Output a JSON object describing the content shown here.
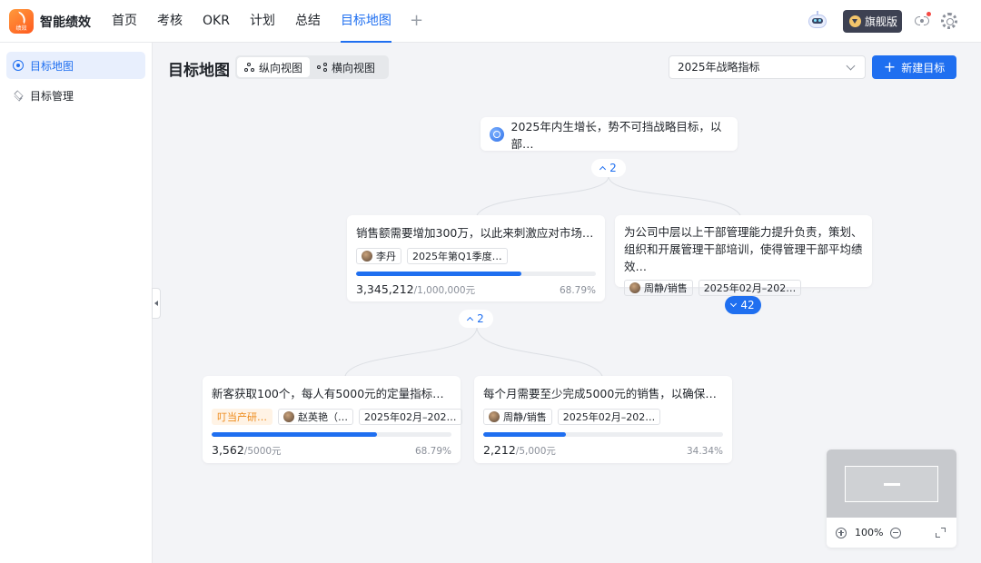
{
  "header": {
    "logo_text": "绩效",
    "app_title": "智能绩效",
    "nav": [
      "首页",
      "考核",
      "OKR",
      "计划",
      "总结",
      "目标地图"
    ],
    "nav_active": "目标地图",
    "edition_badge": "旗舰版"
  },
  "sidebar": {
    "items": [
      {
        "label": "目标地图",
        "active": true
      },
      {
        "label": "目标管理",
        "active": false
      }
    ]
  },
  "toolbar": {
    "page_title": "目标地图",
    "views": [
      "纵向视图",
      "横向视图"
    ],
    "active_view": "纵向视图",
    "select_value": "2025年战略指标",
    "new_button": "新建目标"
  },
  "tree": {
    "root": {
      "title": "2025年内生增长，势不可挡战略目标，以部…",
      "children_count": "2"
    },
    "level1": [
      {
        "title": "销售额需要增加300万，以此来刺激应对市场的…",
        "owner": "李丹",
        "period": "2025年第Q1季度…",
        "progress": 0.6879,
        "current": "3,345,212",
        "target": "/1,000,000元",
        "percent": "68.79%",
        "children_count": "2"
      },
      {
        "title": "为公司中层以上干部管理能力提升负责，策划、组织和开展管理干部培训，使得管理干部平均绩效…",
        "owner": "周静/销售",
        "period": "2025年02月–202…",
        "children_count": "42"
      }
    ],
    "level2": [
      {
        "title": "新客获取100个，每人有5000元的定量指标需要…",
        "dept_tag": "叮当产研…",
        "owner": "赵英艳（…",
        "period": "2025年02月–202…",
        "progress": 0.6879,
        "current": "3,562",
        "target": "/5000元",
        "percent": "68.79%"
      },
      {
        "title": "每个月需要至少完成5000元的销售，以确保目标…",
        "owner": "周静/销售",
        "period": "2025年02月–202…",
        "progress": 0.3434,
        "current": "2,212",
        "target": "/5,000元",
        "percent": "34.34%"
      }
    ]
  },
  "minimap": {
    "zoom": "100%"
  },
  "colors": {
    "primary": "#1f6ff0",
    "orange_tag": "#ed8a19",
    "badge_dark": "#3d4152"
  }
}
